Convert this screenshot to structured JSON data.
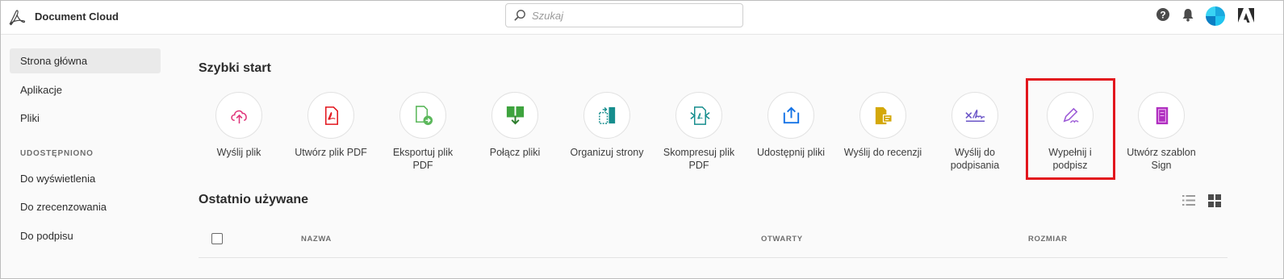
{
  "header": {
    "app_title": "Document Cloud",
    "search_placeholder": "Szukaj"
  },
  "sidebar": {
    "items": [
      {
        "label": "Strona główna",
        "active": true
      },
      {
        "label": "Aplikacje"
      },
      {
        "label": "Pliki"
      }
    ],
    "section_title": "UDOSTĘPNIONO",
    "shared_items": [
      {
        "label": "Do wyświetlenia"
      },
      {
        "label": "Do zrecenzowania"
      },
      {
        "label": "Do podpisu"
      }
    ]
  },
  "quick_start": {
    "title": "Szybki start",
    "tools": [
      {
        "line1": "Wyślij plik",
        "line2": "",
        "icon": "upload-cloud-icon",
        "color": "#e0347a"
      },
      {
        "line1": "Utwórz plik PDF",
        "line2": "",
        "icon": "create-pdf-icon",
        "color": "#e2161d"
      },
      {
        "line1": "Eksportuj plik",
        "line2": "PDF",
        "icon": "export-pdf-icon",
        "color": "#5cb85c"
      },
      {
        "line1": "Połącz pliki",
        "line2": "",
        "icon": "combine-files-icon",
        "color": "#3ea33e"
      },
      {
        "line1": "Organizuj strony",
        "line2": "",
        "icon": "organize-pages-icon",
        "color": "#168d8d"
      },
      {
        "line1": "Skompresuj plik",
        "line2": "PDF",
        "icon": "compress-pdf-icon",
        "color": "#168d8d"
      },
      {
        "line1": "Udostępnij pliki",
        "line2": "",
        "icon": "share-files-icon",
        "color": "#1473e6"
      },
      {
        "line1": "Wyślij do recenzji",
        "line2": "",
        "icon": "send-review-icon",
        "color": "#d4a80a"
      },
      {
        "line1": "Wyślij do",
        "line2": "podpisania",
        "icon": "send-sign-icon",
        "color": "#6a54c7"
      },
      {
        "line1": "Wypełnij i",
        "line2": "podpisz",
        "icon": "fill-sign-icon",
        "color": "#9b59d6"
      },
      {
        "line1": "Utwórz szablon",
        "line2": "Sign",
        "icon": "sign-template-icon",
        "color": "#b02fc0"
      }
    ]
  },
  "recent": {
    "title": "Ostatnio używane",
    "columns": [
      "NAZWA",
      "OTWARTY",
      "ROZMIAR"
    ]
  },
  "colors": {
    "highlight": "#e2161d",
    "sidebar_active": "#eaeaea"
  }
}
